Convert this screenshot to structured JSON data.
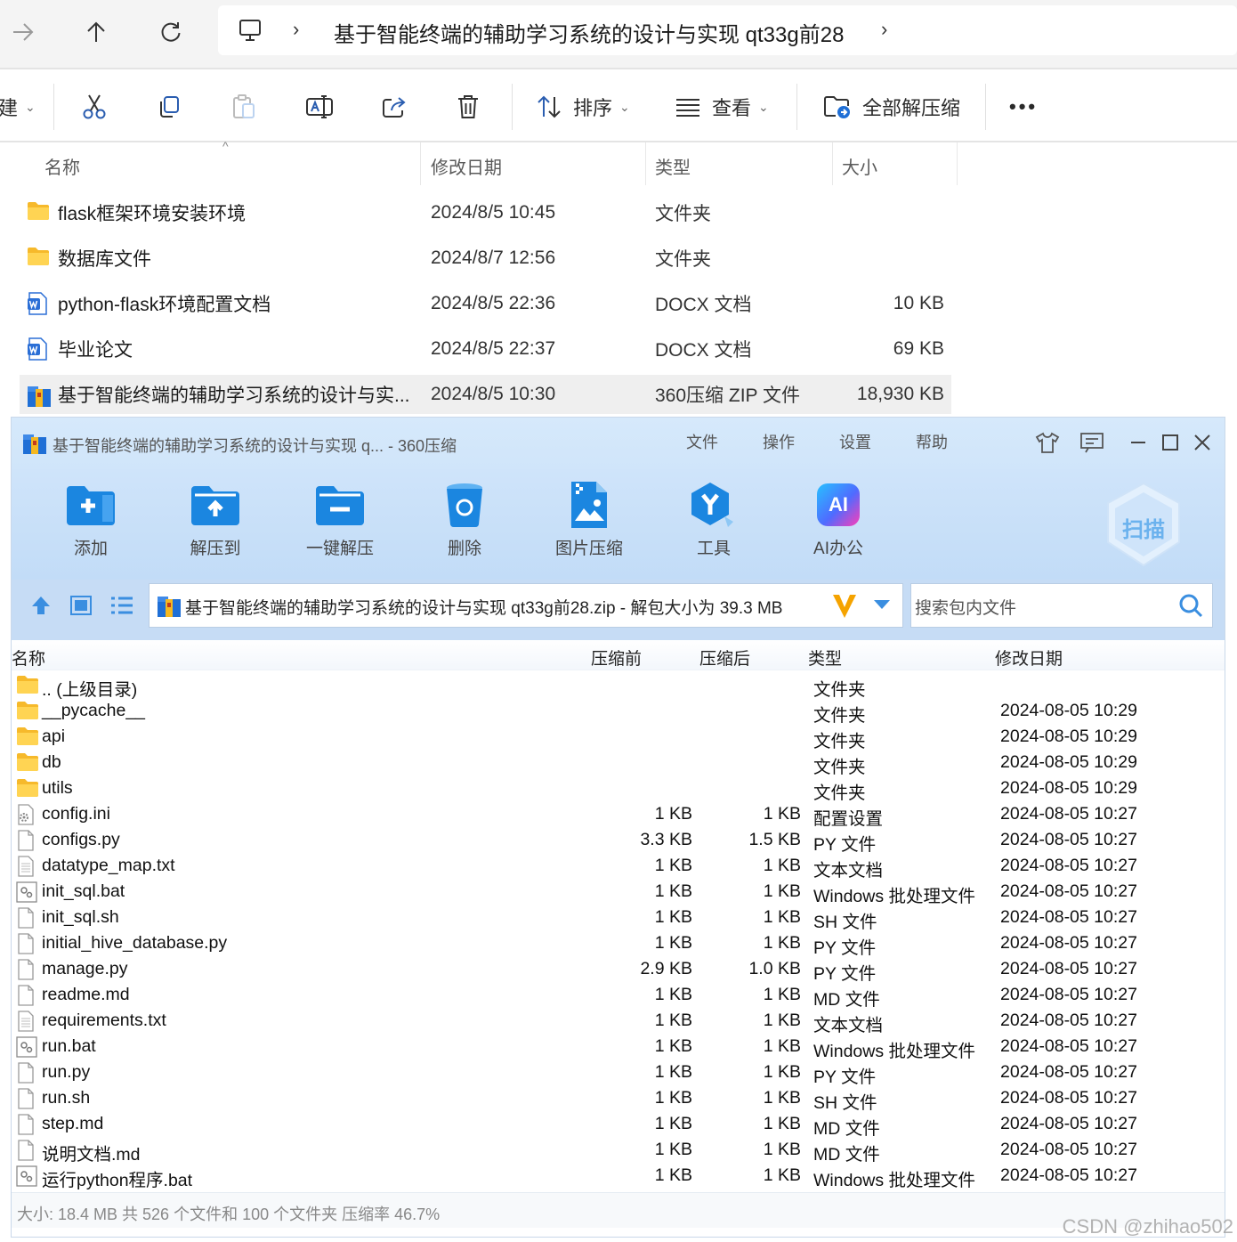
{
  "explorer": {
    "nav": {
      "path": "基于智能终端的辅助学习系统的设计与实现 qt33g前28"
    },
    "cmdbar": {
      "new_partial": "建",
      "sort": "排序",
      "view": "查看",
      "extract_all": "全部解压缩",
      "more": "•••"
    },
    "columns": {
      "name": "名称",
      "date": "修改日期",
      "type": "类型",
      "size": "大小"
    },
    "files": [
      {
        "name": "flask框架环境安装环境",
        "date": "2024/8/5 10:45",
        "type": "文件夹",
        "size": "",
        "icon": "folder-icon"
      },
      {
        "name": "数据库文件",
        "date": "2024/8/7 12:56",
        "type": "文件夹",
        "size": "",
        "icon": "folder-icon"
      },
      {
        "name": "python-flask环境配置文档",
        "date": "2024/8/5 22:36",
        "type": "DOCX 文档",
        "size": "10 KB",
        "icon": "word-doc-icon"
      },
      {
        "name": "毕业论文",
        "date": "2024/8/5 22:37",
        "type": "DOCX 文档",
        "size": "69 KB",
        "icon": "word-doc-icon"
      },
      {
        "name": "基于智能终端的辅助学习系统的设计与实...",
        "date": "2024/8/5 10:30",
        "type": "360压缩 ZIP 文件",
        "size": "18,930 KB",
        "icon": "zip-archive-icon",
        "selected": true
      }
    ]
  },
  "zip": {
    "title": "基于智能终端的辅助学习系统的设计与实现 q... - 360压缩",
    "menu": {
      "file": "文件",
      "ops": "操作",
      "settings": "设置",
      "help": "帮助"
    },
    "toolbar": {
      "add": "添加",
      "extract_to": "解压到",
      "one_click": "一键解压",
      "delete": "删除",
      "img_compress": "图片压缩",
      "tools": "工具",
      "ai_office": "AI办公",
      "ai_badge": "AI",
      "scan": "扫描"
    },
    "address": "基于智能终端的辅助学习系统的设计与实现 qt33g前28.zip - 解包大小为 39.3 MB",
    "search_placeholder": "搜索包内文件",
    "columns": {
      "name": "名称",
      "before": "压缩前",
      "after": "压缩后",
      "type": "类型",
      "date": "修改日期"
    },
    "rows": [
      {
        "name": ".. (上级目录)",
        "before": "",
        "after": "",
        "type": "文件夹",
        "date": "",
        "icon": "folder-icon"
      },
      {
        "name": "__pycache__",
        "before": "",
        "after": "",
        "type": "文件夹",
        "date": "2024-08-05 10:29",
        "icon": "folder-icon"
      },
      {
        "name": "api",
        "before": "",
        "after": "",
        "type": "文件夹",
        "date": "2024-08-05 10:29",
        "icon": "folder-icon"
      },
      {
        "name": "db",
        "before": "",
        "after": "",
        "type": "文件夹",
        "date": "2024-08-05 10:29",
        "icon": "folder-icon"
      },
      {
        "name": "utils",
        "before": "",
        "after": "",
        "type": "文件夹",
        "date": "2024-08-05 10:29",
        "icon": "folder-icon"
      },
      {
        "name": "config.ini",
        "before": "1 KB",
        "after": "1 KB",
        "type": "配置设置",
        "date": "2024-08-05 10:27",
        "icon": "settings-file-icon"
      },
      {
        "name": "configs.py",
        "before": "3.3 KB",
        "after": "1.5 KB",
        "type": "PY 文件",
        "date": "2024-08-05 10:27",
        "icon": "file-icon"
      },
      {
        "name": "datatype_map.txt",
        "before": "1 KB",
        "after": "1 KB",
        "type": "文本文档",
        "date": "2024-08-05 10:27",
        "icon": "text-file-icon"
      },
      {
        "name": "init_sql.bat",
        "before": "1 KB",
        "after": "1 KB",
        "type": "Windows 批处理文件",
        "date": "2024-08-05 10:27",
        "icon": "batch-file-icon"
      },
      {
        "name": "init_sql.sh",
        "before": "1 KB",
        "after": "1 KB",
        "type": "SH 文件",
        "date": "2024-08-05 10:27",
        "icon": "file-icon"
      },
      {
        "name": "initial_hive_database.py",
        "before": "1 KB",
        "after": "1 KB",
        "type": "PY 文件",
        "date": "2024-08-05 10:27",
        "icon": "file-icon"
      },
      {
        "name": "manage.py",
        "before": "2.9 KB",
        "after": "1.0 KB",
        "type": "PY 文件",
        "date": "2024-08-05 10:27",
        "icon": "file-icon"
      },
      {
        "name": "readme.md",
        "before": "1 KB",
        "after": "1 KB",
        "type": "MD 文件",
        "date": "2024-08-05 10:27",
        "icon": "file-icon"
      },
      {
        "name": "requirements.txt",
        "before": "1 KB",
        "after": "1 KB",
        "type": "文本文档",
        "date": "2024-08-05 10:27",
        "icon": "text-file-icon"
      },
      {
        "name": "run.bat",
        "before": "1 KB",
        "after": "1 KB",
        "type": "Windows 批处理文件",
        "date": "2024-08-05 10:27",
        "icon": "batch-file-icon"
      },
      {
        "name": "run.py",
        "before": "1 KB",
        "after": "1 KB",
        "type": "PY 文件",
        "date": "2024-08-05 10:27",
        "icon": "file-icon"
      },
      {
        "name": "run.sh",
        "before": "1 KB",
        "after": "1 KB",
        "type": "SH 文件",
        "date": "2024-08-05 10:27",
        "icon": "file-icon"
      },
      {
        "name": "step.md",
        "before": "1 KB",
        "after": "1 KB",
        "type": "MD 文件",
        "date": "2024-08-05 10:27",
        "icon": "file-icon"
      },
      {
        "name": "说明文档.md",
        "before": "1 KB",
        "after": "1 KB",
        "type": "MD 文件",
        "date": "2024-08-05 10:27",
        "icon": "file-icon"
      },
      {
        "name": "运行python程序.bat",
        "before": "1 KB",
        "after": "1 KB",
        "type": "Windows 批处理文件",
        "date": "2024-08-05 10:27",
        "icon": "batch-file-icon"
      }
    ],
    "status": "大小: 18.4 MB 共 526 个文件和 100 个文件夹 压缩率 46.7%"
  },
  "watermark": "CSDN @zhihao502",
  "colors": {
    "accent": "#1f8de8",
    "zip_title_bg": "#d6e9fb",
    "folder": "#f9c53a",
    "word": "#2b6fd6"
  }
}
